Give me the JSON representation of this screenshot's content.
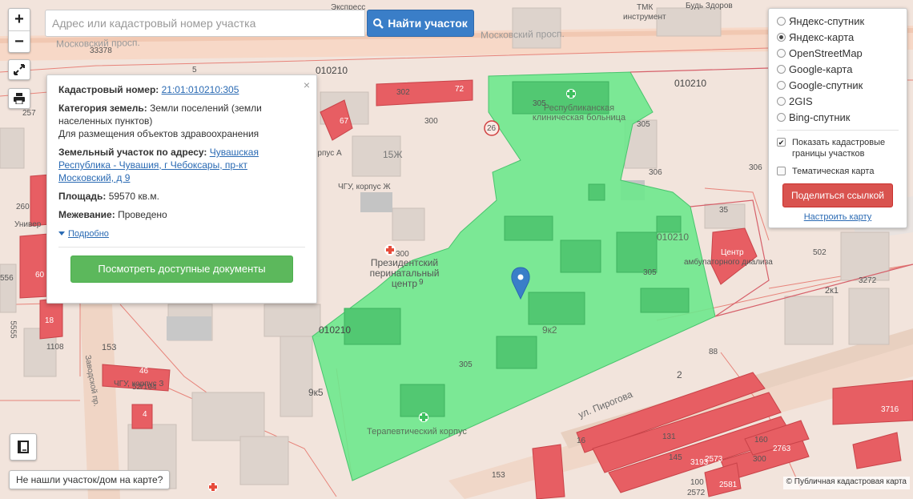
{
  "search": {
    "placeholder": "Адрес или кадастровый номер участка",
    "button_label": "Найти участок"
  },
  "zoom": {
    "plus": "+",
    "minus": "−"
  },
  "icons": {
    "zoom_in": "plus-icon",
    "zoom_out": "minus-icon",
    "fullscreen": "expand-icon",
    "print": "printer-icon",
    "search": "search-icon",
    "legend": "book-icon",
    "marker": "map-marker-icon",
    "hospital": "medical-cross-icon",
    "close": "close-icon"
  },
  "popup": {
    "close": "×",
    "cadastral_label": "Кадастровый номер:",
    "cadastral_value": "21:01:010210:305",
    "category_label": "Категория земель:",
    "category_value": "Земли поселений (земли населенных пунктов)",
    "use_value": "Для размещения объектов здравоохранения",
    "address_label": "Земельный участок по адресу:",
    "address_value": "Чувашская Республика - Чувашия, г Чебоксары, пр-кт Московский, д 9",
    "area_label": "Площадь:",
    "area_value": "59570 кв.м.",
    "survey_label": "Межевание:",
    "survey_value": "Проведено",
    "details_link": "Подробно",
    "docs_button": "Посмотреть доступные документы"
  },
  "layers": {
    "options": [
      {
        "label": "Яндекс-спутник",
        "selected": false
      },
      {
        "label": "Яндекс-карта",
        "selected": true
      },
      {
        "label": "OpenStreetMap",
        "selected": false
      },
      {
        "label": "Google-карта",
        "selected": false
      },
      {
        "label": "Google-спутник",
        "selected": false
      },
      {
        "label": "2GIS",
        "selected": false
      },
      {
        "label": "Bing-спутник",
        "selected": false
      }
    ],
    "show_borders_label": "Показать кадастровые границы участков",
    "show_borders_checked": true,
    "thematic_label": "Тематическая карта",
    "thematic_checked": false,
    "share_button": "Поделиться ссылкой",
    "setup_link": "Настроить карту"
  },
  "bottom": {
    "not_found_button": "Не нашли участок/дом на карте?",
    "copyright": "© Публичная кадастровая карта"
  },
  "map_labels": {
    "street_moskovsky_1": "Московский просп.",
    "street_moskovsky_2": "Московский просп.",
    "street_pirogova": "ул. Пирогова",
    "street_zavodskoy": "Заводской пр.",
    "street_ekspress": "Экспресс",
    "tmk": "ТМК",
    "instrument": "инструмент",
    "bud_zdorov": "Будь Здоров",
    "hospital_republic": "Республиканская клиническая больница",
    "perinatal": "Президентский перинатальный центр",
    "therapy": "Терапевтический корпус",
    "chgu_zh": "ЧГУ, корпус Ж",
    "chgu_z": "ЧГУ, корпус З",
    "korpus_a": "Корпус А",
    "univer": "Универ",
    "dialysis": "амбулаторного диализа",
    "center": "Центр",
    "q1": "010210",
    "q2": "010210",
    "q3": "010210",
    "n305a": "305",
    "n305b": "305",
    "n305c": "305",
    "n305d": "305",
    "n300a": "300",
    "n300b": "300",
    "n300c": "300",
    "n306a": "306",
    "n306b": "306",
    "n302": "302",
    "n72": "72",
    "n26": "26",
    "n15zh": "15Ж",
    "n9k2": "9к2",
    "n9k5": "9к5",
    "n153a": "153",
    "n153b": "153",
    "n88": "88",
    "n2": "2",
    "n35": "35",
    "n2k1": "2к1",
    "n3716": "3716",
    "n160": "160",
    "n145": "145",
    "n131": "131",
    "n100": "100",
    "n2572": "2572",
    "n260": "260",
    "n556": "556",
    "n5555": "5555",
    "n257": "257",
    "n33378": "33378",
    "n60": "60",
    "n1108": "1108",
    "n46": "46",
    "n52104": "52/104",
    "n3272": "3272",
    "n502": "502",
    "n1": "1",
    "n16": "16",
    "n2763": "2763",
    "n2573": "2573",
    "n3193": "3193",
    "n2581": "2581",
    "n4": "4",
    "n88b": "88",
    "n9": "9",
    "n5": "5",
    "n67": "67",
    "n18": "18"
  }
}
